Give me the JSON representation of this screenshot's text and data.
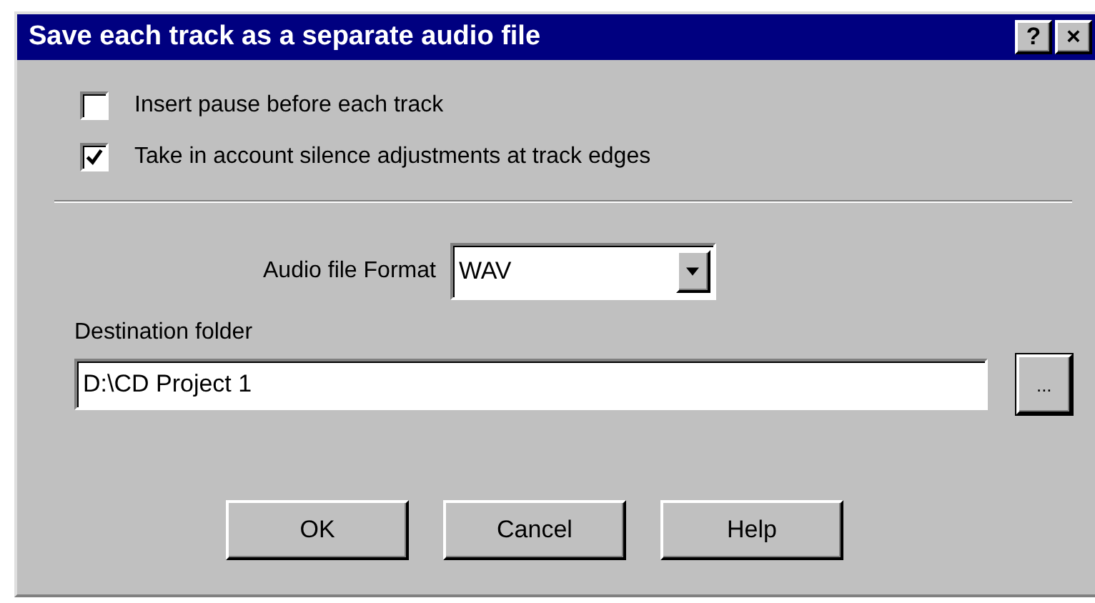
{
  "window": {
    "title": "Save each track as a separate audio file",
    "title_buttons": [
      "?",
      "×"
    ]
  },
  "options": [
    {
      "label": "Insert pause before each track",
      "checked": false
    },
    {
      "label": "Take in account silence adjustments at track edges",
      "checked": true
    }
  ],
  "format": {
    "label": "Audio file Format",
    "value": "WAV"
  },
  "destination": {
    "label": "Destination folder",
    "value": "D:\\CD Project 1",
    "browse": "..."
  },
  "buttons": [
    "OK",
    "Cancel",
    "Help"
  ]
}
